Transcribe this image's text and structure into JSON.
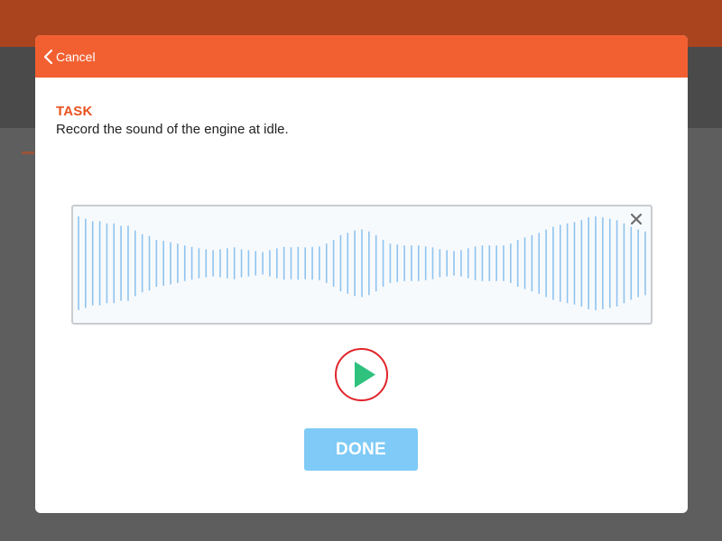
{
  "modal": {
    "cancel_label": "Cancel",
    "task_heading": "TASK",
    "task_text": "Record the sound of the engine at idle.",
    "done_label": "DONE"
  },
  "icons": {
    "back": "chevron-left-icon",
    "close": "close-icon",
    "play": "play-icon"
  },
  "colors": {
    "header": "#f26031",
    "accent_text": "#e8521e",
    "waveform": "#8fc3ef",
    "play_ring": "#e0242b",
    "play_triangle": "#2ec27e",
    "done_button": "#7fcaf6"
  },
  "waveform": {
    "amplitudes": [
      1.0,
      0.95,
      0.9,
      0.9,
      0.85,
      0.85,
      0.8,
      0.8,
      0.7,
      0.62,
      0.58,
      0.5,
      0.48,
      0.45,
      0.42,
      0.38,
      0.35,
      0.32,
      0.3,
      0.28,
      0.3,
      0.32,
      0.34,
      0.3,
      0.28,
      0.26,
      0.24,
      0.28,
      0.32,
      0.35,
      0.34,
      0.35,
      0.34,
      0.35,
      0.36,
      0.42,
      0.5,
      0.6,
      0.65,
      0.7,
      0.72,
      0.68,
      0.6,
      0.5,
      0.42,
      0.4,
      0.38,
      0.38,
      0.38,
      0.36,
      0.34,
      0.3,
      0.28,
      0.26,
      0.28,
      0.32,
      0.36,
      0.38,
      0.38,
      0.38,
      0.38,
      0.42,
      0.5,
      0.55,
      0.6,
      0.65,
      0.72,
      0.78,
      0.82,
      0.85,
      0.88,
      0.92,
      0.98,
      1.0,
      0.98,
      0.95,
      0.92,
      0.85,
      0.78,
      0.72,
      0.68,
      0.65
    ]
  }
}
